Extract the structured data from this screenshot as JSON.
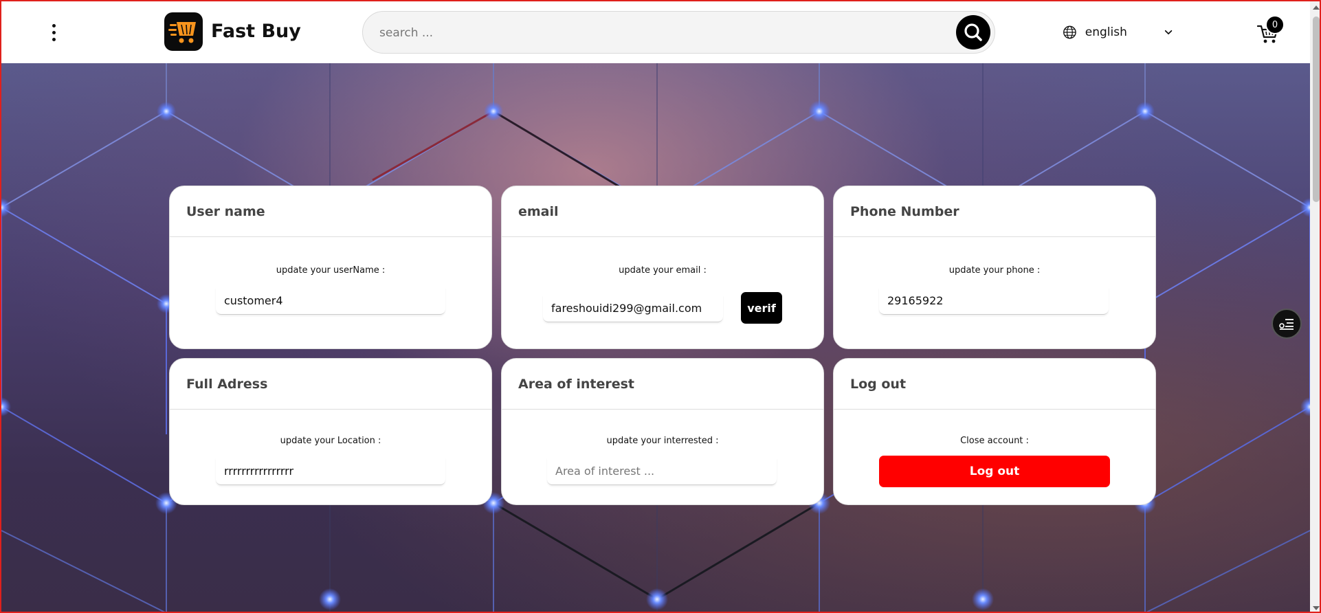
{
  "header": {
    "brand": "Fast Buy",
    "search_placeholder": "search ...",
    "language": "english",
    "cart_count": "0"
  },
  "cards": {
    "username": {
      "title": "User name",
      "label": "update your userName :",
      "value": "customer4"
    },
    "email": {
      "title": "email",
      "label": "update your email :",
      "value": "fareshouidi299@gmail.com",
      "verify_label": "verif"
    },
    "phone": {
      "title": "Phone Number",
      "label": "update your phone :",
      "value": "29165922"
    },
    "address": {
      "title": "Full Adress",
      "label": "update your Location :",
      "value": "rrrrrrrrrrrrrrrr"
    },
    "interest": {
      "title": "Area of interest",
      "label": "update your interrested :",
      "placeholder": "Area of interest ..."
    },
    "logout": {
      "title": "Log out",
      "label": "Close account :",
      "button_label": "Log out"
    }
  },
  "colors": {
    "accent_black": "#000000",
    "logout_red": "#ff0000",
    "logo_orange": "#f7941d",
    "frame_red": "#e0201c"
  },
  "icons": {
    "menu": "vertical-dots-icon",
    "search": "search-icon",
    "language": "globe-icon",
    "dropdown": "chevron-down-icon",
    "cart": "cart-icon",
    "floating": "filter-list-icon"
  }
}
